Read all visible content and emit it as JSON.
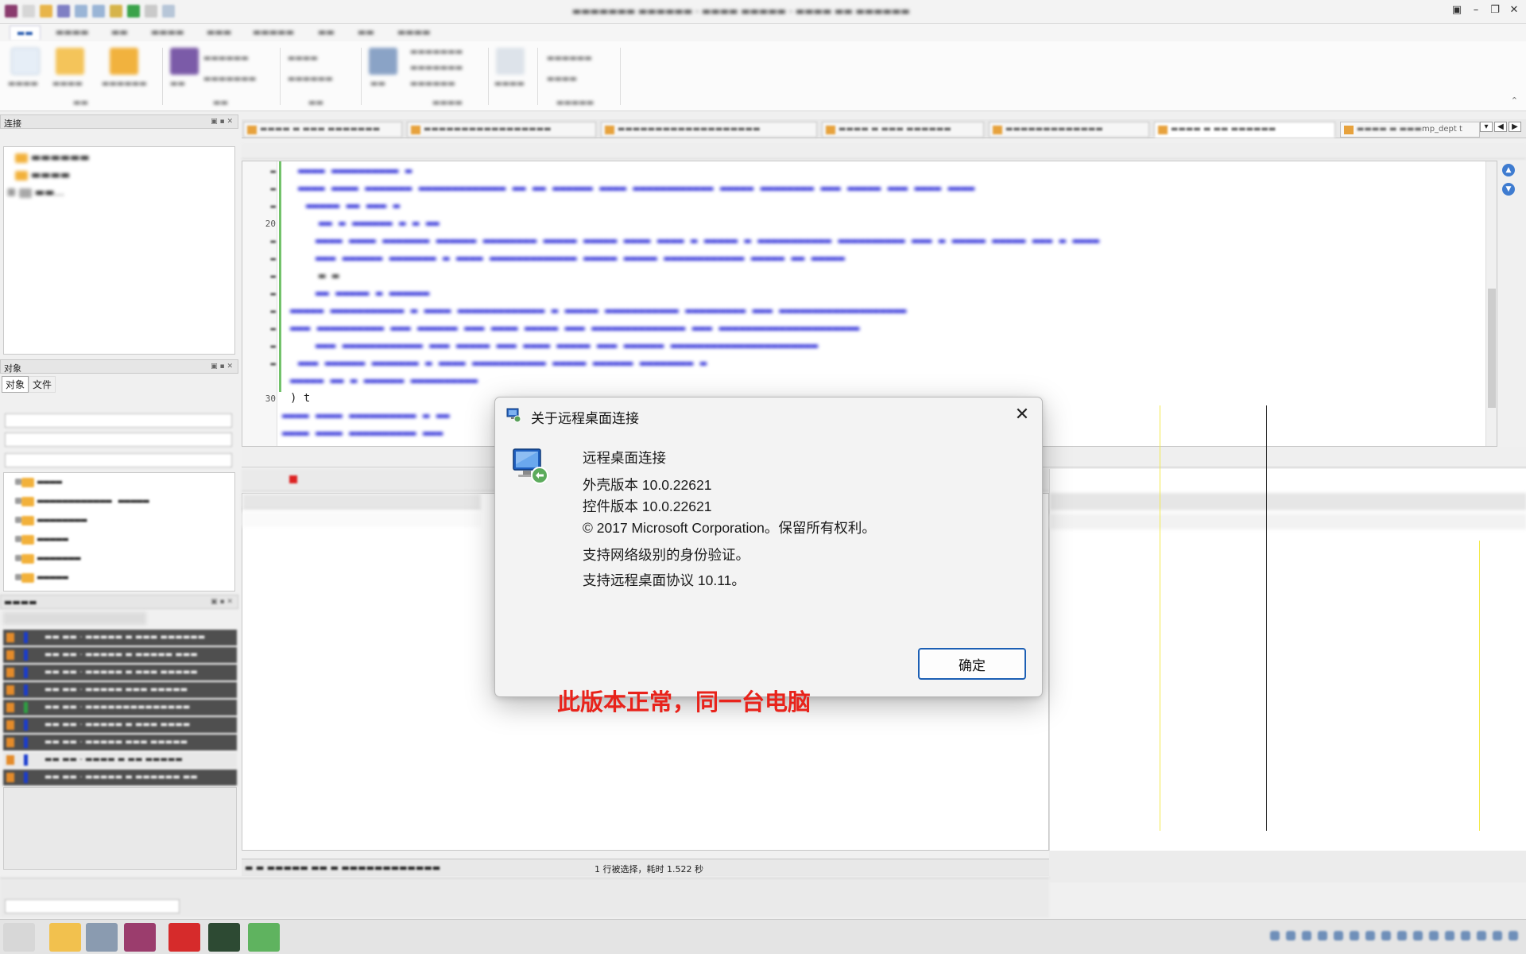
{
  "dialog": {
    "title": "关于远程桌面连接",
    "app_name": "远程桌面连接",
    "shell_version": "外壳版本 10.0.22621",
    "control_version": "控件版本 10.0.22621",
    "copyright": "© 2017 Microsoft Corporation。保留所有权利。",
    "nla_support": "支持网络级别的身份验证。",
    "protocol_support": "支持远程桌面协议 10.11。",
    "ok_label": "确定",
    "close_glyph": "✕"
  },
  "annotation": "此版本正常，同一台电脑",
  "left_panels": {
    "connections_title": "连接",
    "objects_title": "对象",
    "objects_tab_objects": "对象",
    "objects_tab_files": "文件"
  },
  "editor": {
    "visible_line_numbers": [
      "20",
      "30"
    ],
    "visible_code": ") t"
  },
  "status": {
    "selection_text": "1 行被选择，耗时 1.522 秒"
  },
  "editor_tabs": {
    "last_tab_text": "mp_dept t"
  },
  "colors": {
    "accent": "#1c5fb4",
    "annotation": "#e8231b",
    "sql_text": "#1b1bd4"
  },
  "icons": {
    "dialog_title": "remote-desktop-icon",
    "dialog_big": "remote-desktop-computer-icon",
    "close": "close-icon",
    "help": "help-icon",
    "info": "info-icon"
  }
}
